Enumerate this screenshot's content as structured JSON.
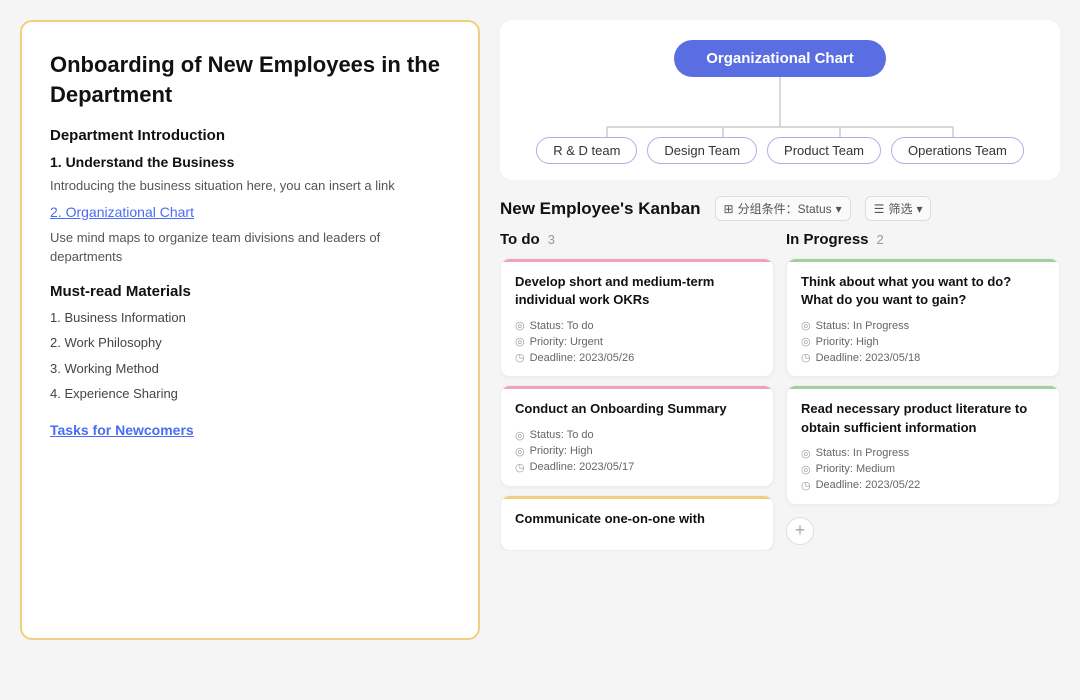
{
  "left": {
    "title": "Onboarding of New Employees in the Department",
    "section1": {
      "heading": "Department Introduction",
      "item1": {
        "label": "1. Understand the Business",
        "desc": "Introducing the business situation here, you can insert a link"
      },
      "item2": {
        "label": "2. Organizational Chart",
        "desc": "Use mind maps to organize team divisions and leaders of departments"
      }
    },
    "section2": {
      "heading": "Must-read Materials",
      "items": [
        "1. Business Information",
        "2. Work Philosophy",
        "3. Working Method",
        "4. Experience Sharing"
      ]
    },
    "tasks_link": "Tasks for Newcomers"
  },
  "org_chart": {
    "root": "Organizational Chart",
    "children": [
      "R & D team",
      "Design Team",
      "Product Team",
      "Operations Team"
    ]
  },
  "kanban": {
    "title": "New Employee's Kanban",
    "filter1_icon": "grid-icon",
    "filter1_label": "分组条件：Status",
    "filter2_label": "筛选",
    "columns": [
      {
        "title": "To do",
        "count": "3",
        "cards": [
          {
            "title": "Develop short and medium-term individual work OKRs",
            "status": "Status: To do",
            "priority": "Priority: Urgent",
            "deadline": "Deadline: 2023/05/26",
            "type": "todo"
          },
          {
            "title": "Conduct an Onboarding Summary",
            "status": "Status: To do",
            "priority": "Priority: High",
            "deadline": "Deadline: 2023/05/17",
            "type": "todo"
          },
          {
            "title": "Communicate one-on-one with",
            "status": "",
            "priority": "",
            "deadline": "",
            "type": "yellow"
          }
        ]
      },
      {
        "title": "In Progress",
        "count": "2",
        "cards": [
          {
            "title": "Think about what you want to do? What do you want to gain?",
            "status": "Status: In Progress",
            "priority": "Priority: High",
            "deadline": "Deadline: 2023/05/18",
            "type": "inprogress"
          },
          {
            "title": "Read necessary product literature to obtain sufficient information",
            "status": "Status: In Progress",
            "priority": "Priority: Medium",
            "deadline": "Deadline: 2023/05/22",
            "type": "inprogress"
          }
        ]
      }
    ],
    "add_label": "+"
  }
}
